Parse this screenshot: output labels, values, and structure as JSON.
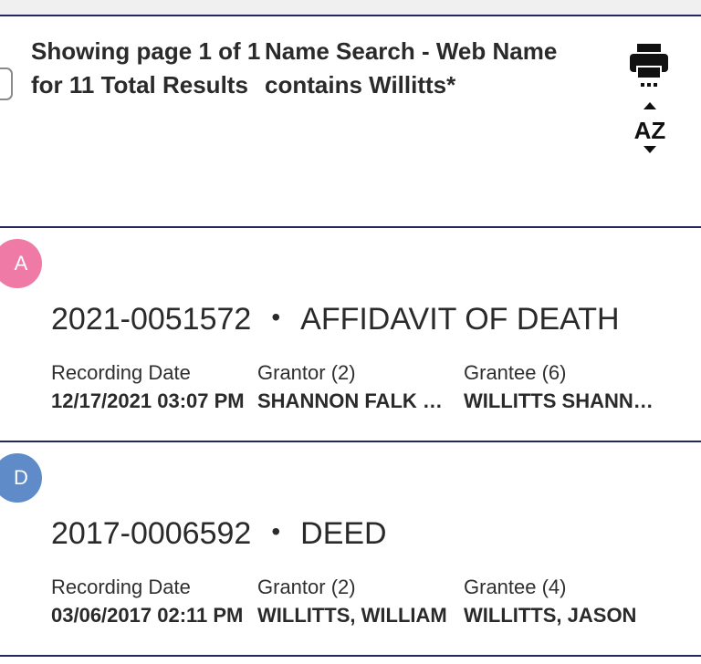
{
  "header": {
    "showing_text": "Showing page 1 of 1 for 11 Total Results",
    "search_text": "Name Search - Web Name contains Willitts*",
    "print_icon": "printer-icon",
    "sort_icon": "sort-az-icon"
  },
  "results": [
    {
      "avatar_letter": "A",
      "avatar_color": "#ee7aa5",
      "doc_number": "2021-0051572",
      "separator": "•",
      "doc_type": "AFFIDAVIT OF DEATH",
      "recording_date_label": "Recording Date",
      "recording_date": "12/17/2021 03:07 PM",
      "grantor_label": "Grantor (2)",
      "grantor": "SHANNON FALK WILLITTS",
      "grantee_label": "Grantee (6)",
      "grantee": "WILLITTS SHANNON FALK"
    },
    {
      "avatar_letter": "D",
      "avatar_color": "#5f8cc8",
      "doc_number": "2017-0006592",
      "separator": "•",
      "doc_type": "DEED",
      "recording_date_label": "Recording Date",
      "recording_date": "03/06/2017 02:11 PM",
      "grantor_label": "Grantor (2)",
      "grantor": "WILLITTS, WILLIAM",
      "grantee_label": "Grantee (4)",
      "grantee": "WILLITTS, JASON"
    }
  ]
}
